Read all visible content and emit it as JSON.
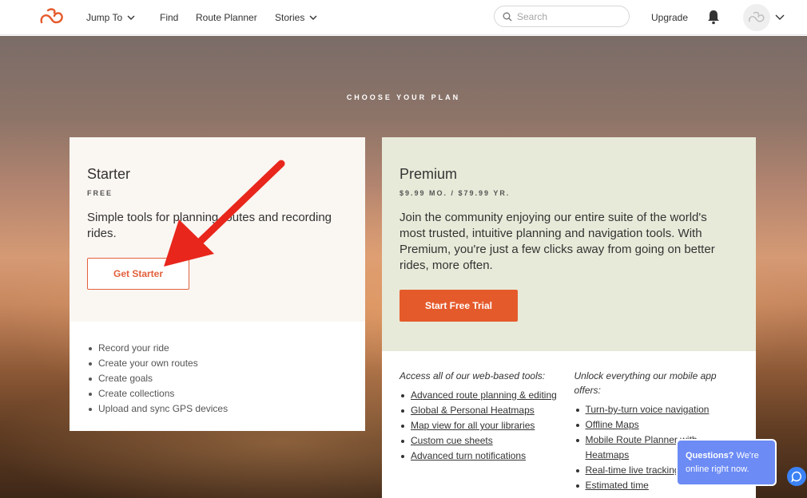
{
  "nav": {
    "jump_to": "Jump To",
    "find": "Find",
    "route_planner": "Route Planner",
    "stories": "Stories",
    "search_placeholder": "Search",
    "upgrade": "Upgrade"
  },
  "hero": {
    "heading": "CHOOSE YOUR PLAN"
  },
  "starter": {
    "name": "Starter",
    "price": "FREE",
    "description": "Simple tools for planning routes and recording rides.",
    "button": "Get Starter",
    "features": [
      "Record your ride",
      "Create your own routes",
      "Create goals",
      "Create collections",
      "Upload and sync GPS devices"
    ]
  },
  "premium": {
    "name": "Premium",
    "price": "$9.99 MO. / $79.99 YR.",
    "description": "Join the community enjoying our entire suite of the world's most trusted, intuitive planning and navigation tools. With Premium, you're just a few clicks away from going on better rides, more often.",
    "button": "Start Free Trial",
    "web": {
      "heading": "Access all of our web-based tools:",
      "items": [
        "Advanced route planning & editing",
        "Global & Personal Heatmaps",
        "Map view for all your libraries",
        "Custom cue sheets",
        "Advanced turn notifications"
      ]
    },
    "mobile": {
      "heading": "Unlock everything our mobile app offers:",
      "items": [
        "Turn-by-turn voice navigation",
        "Offline Maps",
        "Mobile Route Planner with Heatmaps",
        "Real-time live tracking",
        "Estimated time"
      ]
    }
  },
  "chat": {
    "bold": "Questions?",
    "text": " We're online right now."
  },
  "colors": {
    "accent": "#e55a2b",
    "chat": "#6c8bf5",
    "arrow": "#e8261c"
  }
}
